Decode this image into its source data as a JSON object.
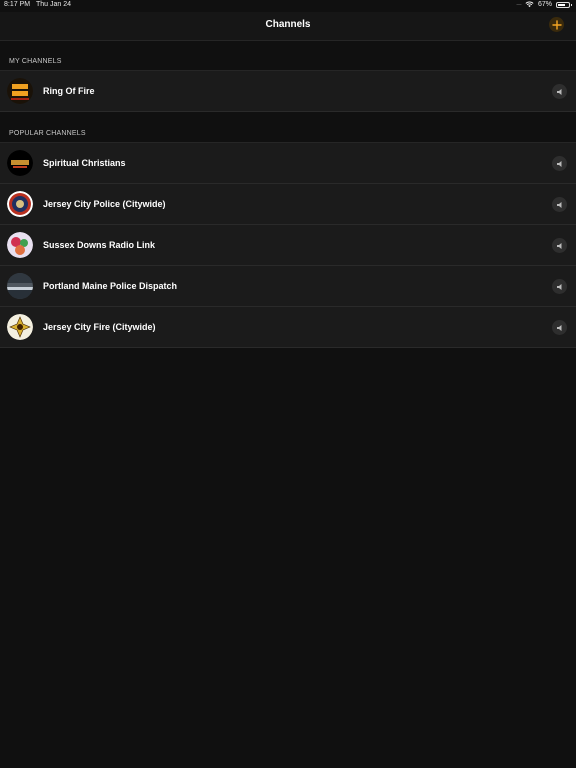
{
  "status": {
    "time": "8:17 PM",
    "date": "Thu Jan 24",
    "battery": "67%",
    "battery_level": 0.67
  },
  "nav": {
    "title": "Channels",
    "add_icon": "plus-icon"
  },
  "sections": {
    "my_channels": {
      "header": "MY CHANNELS",
      "items": [
        {
          "label": "Ring Of Fire",
          "avatar_icon": "trivia-teasers-logo"
        }
      ]
    },
    "popular": {
      "header": "POPULAR CHANNELS",
      "items": [
        {
          "label": "Spiritual Christians",
          "avatar_icon": "spiritual-christians-logo"
        },
        {
          "label": "Jersey City Police (Citywide)",
          "avatar_icon": "police-badge-icon"
        },
        {
          "label": "Sussex Downs Radio Link",
          "avatar_icon": "radio-link-icon"
        },
        {
          "label": "Portland Maine Police Dispatch",
          "avatar_icon": "city-skyline-icon"
        },
        {
          "label": "Jersey City Fire (Citywide)",
          "avatar_icon": "fire-badge-icon"
        }
      ]
    }
  },
  "colors": {
    "accent": "#f5a623",
    "background": "#101010",
    "row": "#1b1b1b"
  }
}
